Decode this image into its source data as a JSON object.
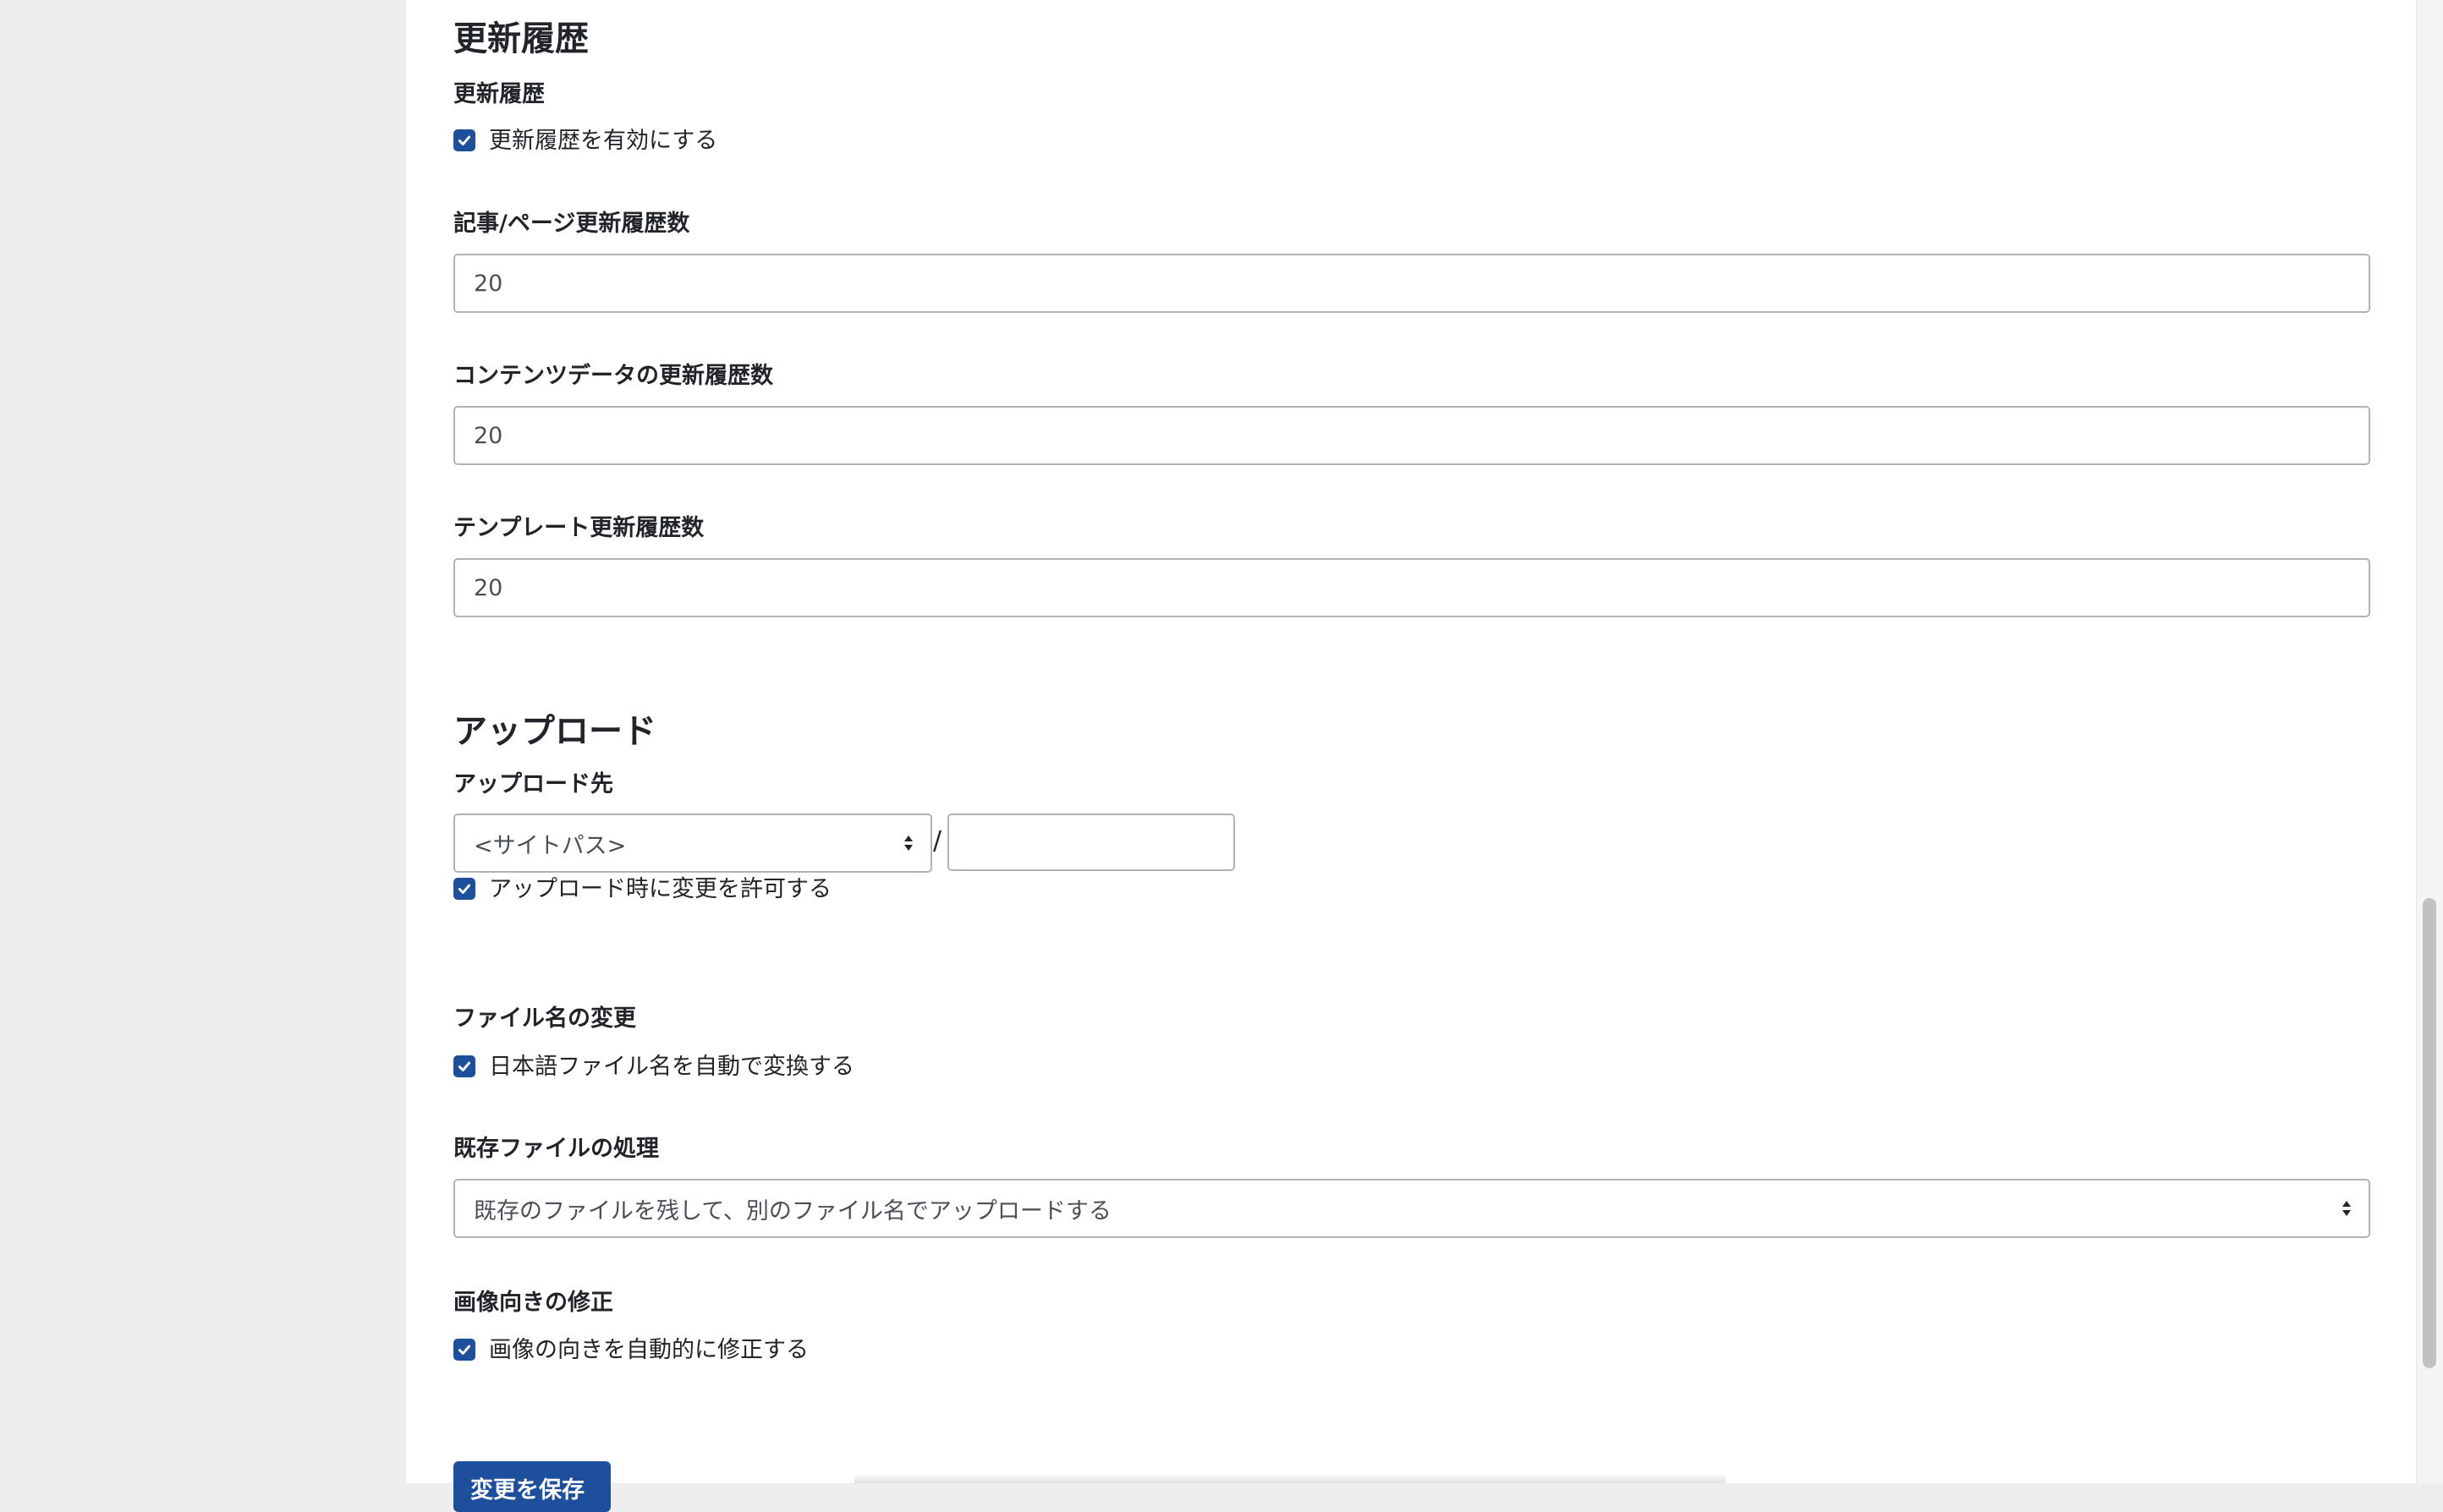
{
  "history": {
    "heading": "更新履歴",
    "enable_label": "更新履歴",
    "enable_checkbox": {
      "label": "更新履歴を有効にする",
      "checked": true
    },
    "entry_page_count": {
      "label": "記事/ページ更新履歴数",
      "value": "20"
    },
    "content_data_count": {
      "label": "コンテンツデータの更新履歴数",
      "value": "20"
    },
    "template_count": {
      "label": "テンプレート更新履歴数",
      "value": "20"
    }
  },
  "upload": {
    "heading": "アップロード",
    "destination": {
      "label": "アップロード先",
      "select_value": "<サイトパス>",
      "separator": "/",
      "path_value": "",
      "allow_change": {
        "label": "アップロード時に変更を許可する",
        "checked": true
      }
    },
    "rename": {
      "label": "ファイル名の変更",
      "checkbox": {
        "label": "日本語ファイル名を自動で変換する",
        "checked": true
      }
    },
    "existing_files": {
      "label": "既存ファイルの処理",
      "select_value": "既存のファイルを残して、別のファイル名でアップロードする"
    },
    "orientation": {
      "label": "画像向きの修正",
      "checkbox": {
        "label": "画像の向きを自動的に修正する",
        "checked": true
      }
    }
  },
  "submit": {
    "label": "変更を保存"
  },
  "colors": {
    "accent": "#1d4f9c",
    "background": "#eeeeee",
    "panel": "#ffffff",
    "border": "#aeb4ba"
  }
}
